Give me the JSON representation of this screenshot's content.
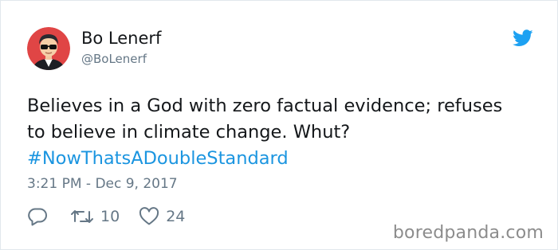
{
  "tweet": {
    "author_name": "Bo Lenerf",
    "author_handle": "@BoLenerf",
    "text_line1": "Believes in a God with zero factual evidence; refuses",
    "text_line2": "to believe in climate change. Whut?",
    "hashtag": "#NowThatsADoubleStandard",
    "timestamp": "3:21 PM - Dec 9, 2017",
    "retweet_count": "10",
    "like_count": "24"
  },
  "watermark": "boredpanda.com",
  "colors": {
    "accent": "#1da1f2",
    "hashtag": "#1b95e0",
    "muted": "#657786",
    "avatar_bg": "#e04545"
  },
  "icons": {
    "brand": "twitter-bird-icon",
    "reply": "reply-icon",
    "retweet": "retweet-icon",
    "like": "heart-icon"
  }
}
